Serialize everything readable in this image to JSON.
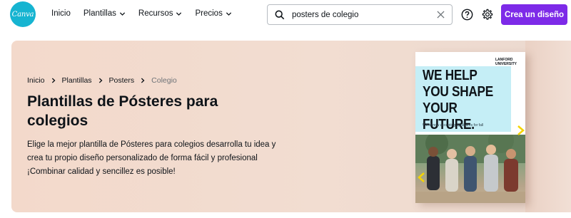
{
  "app": {
    "logo_text": "Canva",
    "brand_color": "#16b4d1",
    "accent_color": "#7d2ae8"
  },
  "nav": {
    "items": [
      {
        "label": "Inicio",
        "has_dropdown": false
      },
      {
        "label": "Plantillas",
        "has_dropdown": true
      },
      {
        "label": "Recursos",
        "has_dropdown": true
      },
      {
        "label": "Precios",
        "has_dropdown": true
      }
    ]
  },
  "search": {
    "value": "posters de colegio",
    "icon": "search-icon"
  },
  "header_actions": {
    "help_icon": "help-circle-icon",
    "settings_icon": "gear-icon",
    "create_label": "Crea un diseño"
  },
  "hero": {
    "breadcrumb": [
      "Inicio",
      "Plantillas",
      "Posters",
      "Colegio"
    ],
    "title": "Plantillas de Pósteres para colegios",
    "description": "Elige la mejor plantilla de Pósteres para colegios desarrolla tu idea y crea tu propio diseño personalizado de forma fácil y profesional ¡Combinar calidad y sencillez es posible!"
  },
  "poster": {
    "brand": "LANFORD UNIVERSITY",
    "headline_lines": [
      "WE HELP",
      "YOU SHAPE",
      "YOUR FUTURE."
    ],
    "subline": "We're now accepting applicants for fall"
  }
}
